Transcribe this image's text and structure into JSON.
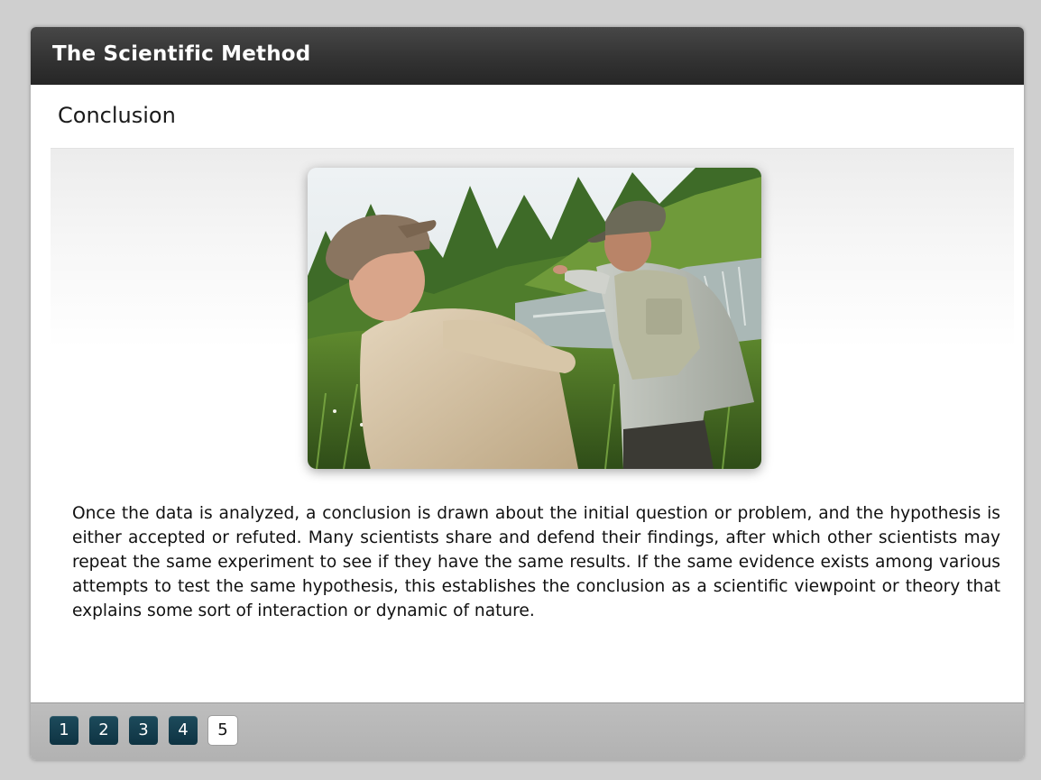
{
  "header": {
    "title": "The Scientific Method"
  },
  "section": {
    "title": "Conclusion"
  },
  "image": {
    "description_name": "scientists-field-photo"
  },
  "body": {
    "text": "Once the data is analyzed, a conclusion is drawn about the initial question or problem, and the hypothesis is either accepted or refuted. Many scientists share and defend their findings, after which other scientists may repeat the same experiment to see if they have the same results. If the same evidence exists among various attempts to test the same hypothesis, this establishes the conclusion as a scientific viewpoint or theory that explains some sort of interaction or dynamic of nature."
  },
  "pagination": {
    "pages": [
      {
        "label": "1",
        "active": false
      },
      {
        "label": "2",
        "active": false
      },
      {
        "label": "3",
        "active": false
      },
      {
        "label": "4",
        "active": false
      },
      {
        "label": "5",
        "active": true
      }
    ]
  },
  "colors": {
    "titlebar": "#333333",
    "page_button": "#0e3342",
    "page_button_active": "#ffffff",
    "footer": "#b6b6b6"
  }
}
